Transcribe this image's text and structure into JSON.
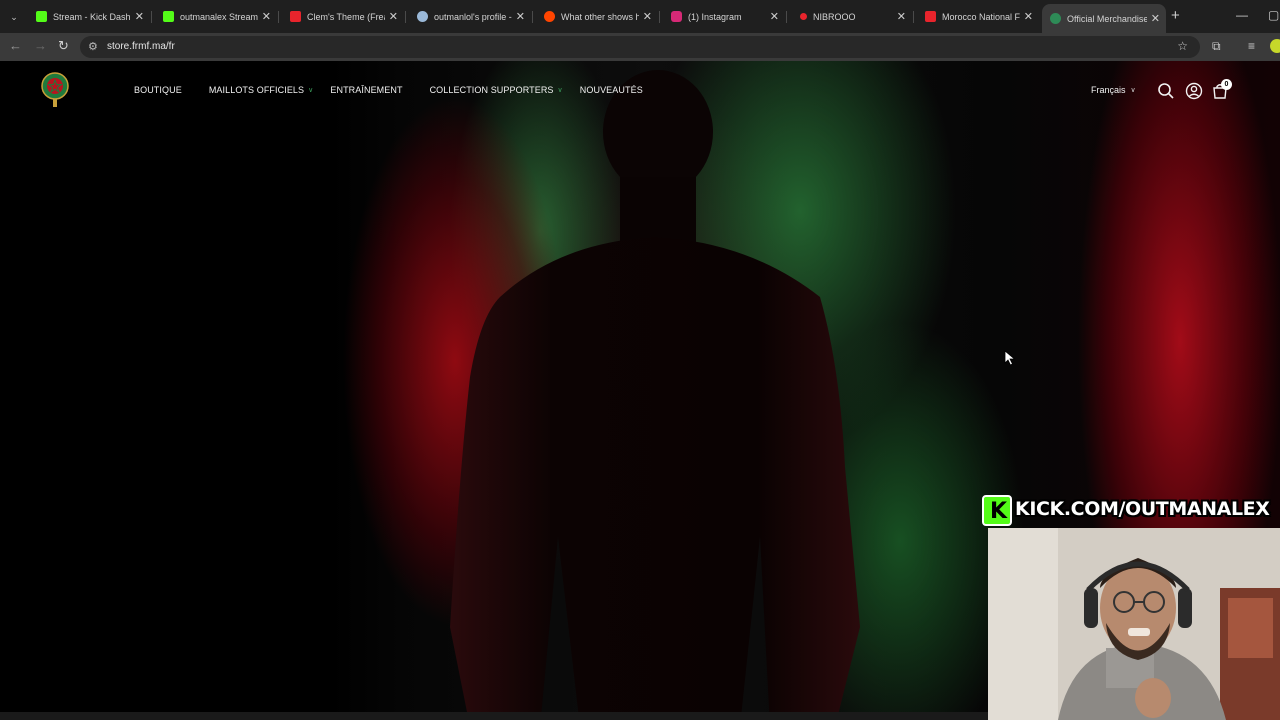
{
  "browser": {
    "tabs": [
      {
        "title": "Stream - Kick Dashbo",
        "favicon_color": "#53fc18"
      },
      {
        "title": "outmanalex Stream -",
        "favicon_color": "#53fc18"
      },
      {
        "title": "Clem's Theme (Freak",
        "favicon_color": "#e8242c"
      },
      {
        "title": "outmanlol's profile -",
        "favicon_color": "#9ab8d8"
      },
      {
        "title": "What other shows ha",
        "favicon_color": "#ff4500"
      },
      {
        "title": "(1) Instagram",
        "favicon_color": "#d62976"
      },
      {
        "title": "NIBROOO",
        "favicon_color": "#e8242c"
      },
      {
        "title": "Morocco National Fo",
        "favicon_color": "#e8242c"
      },
      {
        "title": "Official Merchandise",
        "favicon_color": "#2e8b57",
        "active": true
      }
    ],
    "url": "store.frmf.ma/fr"
  },
  "site": {
    "nav": [
      {
        "label": "BOUTIQUE",
        "has_dropdown": false
      },
      {
        "label": "MAILLOTS OFFICIELS",
        "has_dropdown": true
      },
      {
        "label": "ENTRAÎNEMENT",
        "has_dropdown": false
      },
      {
        "label": "COLLECTION SUPPORTERS",
        "has_dropdown": true
      },
      {
        "label": "NOUVEAUTÉS",
        "has_dropdown": false
      }
    ],
    "language": "Français",
    "cart_count": "0"
  },
  "overlay": {
    "kick_url": "KICK.COM/OUTMANALEX"
  },
  "colors": {
    "accent_green": "#3a9a5a",
    "kick_green": "#53fc18",
    "curtain_red": "#a8101c"
  }
}
